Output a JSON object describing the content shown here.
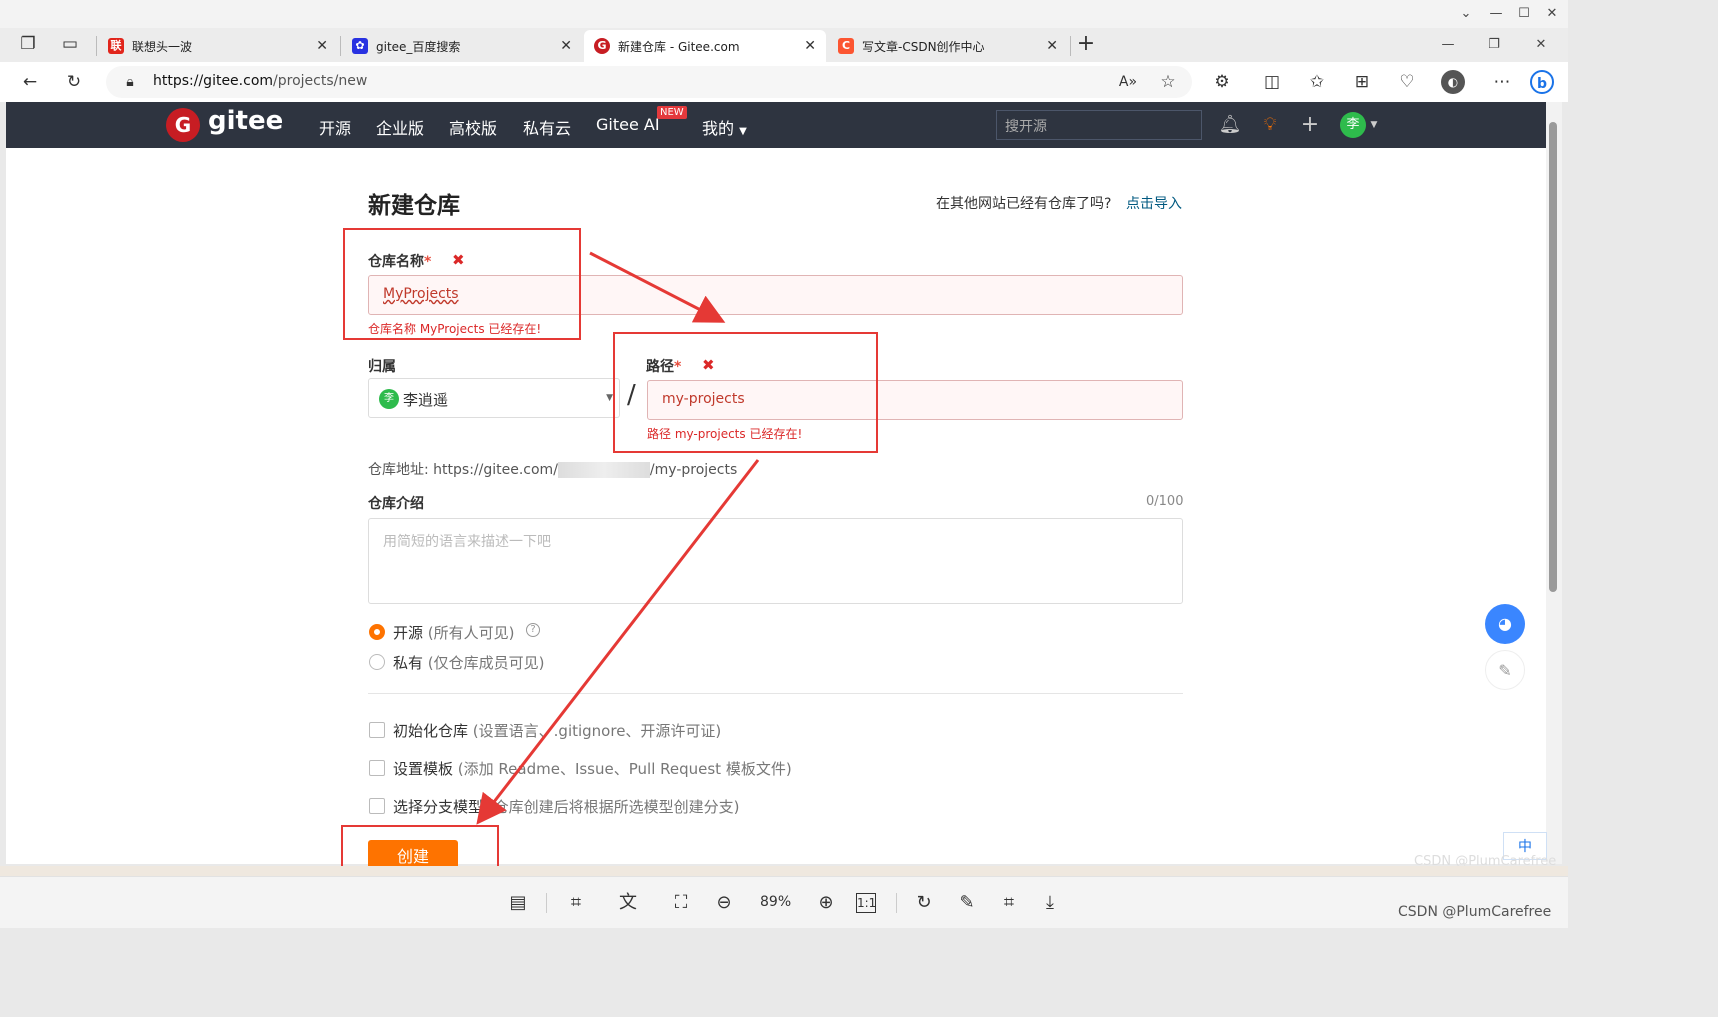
{
  "browser": {
    "tabs": [
      {
        "title": "联想头一波",
        "favicon_color": "#e1251b",
        "favicon": "联",
        "active": false
      },
      {
        "title": "gitee_百度搜索",
        "favicon_color": "#2932e1",
        "favicon": "✿",
        "active": false
      },
      {
        "title": "新建仓库 - Gitee.com",
        "favicon_color": "#c71d23",
        "favicon": "G",
        "active": true
      },
      {
        "title": "写文章-CSDN创作中心",
        "favicon_color": "#fc5531",
        "favicon": "C",
        "active": false
      }
    ],
    "url_host": "https://gitee.com",
    "url_path": "/projects/new",
    "new_tab_icon": "plus-icon"
  },
  "gitee_nav": {
    "logo_text": "gitee",
    "items": [
      "开源",
      "企业版",
      "高校版",
      "私有云",
      "Gitee AI",
      "我的"
    ],
    "new_badge": "NEW",
    "search_placeholder": "搜开源",
    "avatar_letter": "李"
  },
  "form": {
    "heading": "新建仓库",
    "import_question": "在其他网站已经有仓库了吗?",
    "import_link": "点击导入",
    "repo_name_label": "仓库名称",
    "required_mark": "*",
    "repo_name_value": "MyProjects",
    "repo_name_error": "仓库名称 MyProjects 已经存在!",
    "owner_label": "归属",
    "owner_name": "李逍遥",
    "owner_avatar": "李",
    "slash": "/",
    "path_label": "路径",
    "path_value": "my-projects",
    "path_error": "路径 my-projects 已经存在!",
    "repo_url_label": "仓库地址:",
    "repo_url_prefix": "https://gitee.com/",
    "repo_url_suffix": "/my-projects",
    "desc_label": "仓库介绍",
    "desc_counter": "0/100",
    "desc_placeholder": "用简短的语言来描述一下吧",
    "visibility": [
      {
        "label": "开源",
        "hint": "(所有人可见)",
        "selected": true
      },
      {
        "label": "私有",
        "hint": "(仅仓库成员可见)",
        "selected": false
      }
    ],
    "options": [
      {
        "label": "初始化仓库",
        "hint": "(设置语言、.gitignore、开源许可证)",
        "checked": false
      },
      {
        "label": "设置模板",
        "hint": "(添加 Readme、Issue、Pull Request 模板文件)",
        "checked": false
      },
      {
        "label": "选择分支模型",
        "hint": "(仓库创建后将根据所选模型创建分支)",
        "checked": false
      }
    ],
    "create_button": "创建",
    "accent_color": "#fe7300",
    "error_color": "#db2828"
  },
  "side": {
    "ime_label": "中"
  },
  "viewer": {
    "zoom": "89%"
  },
  "watermark": "CSDN @PlumCarefree"
}
